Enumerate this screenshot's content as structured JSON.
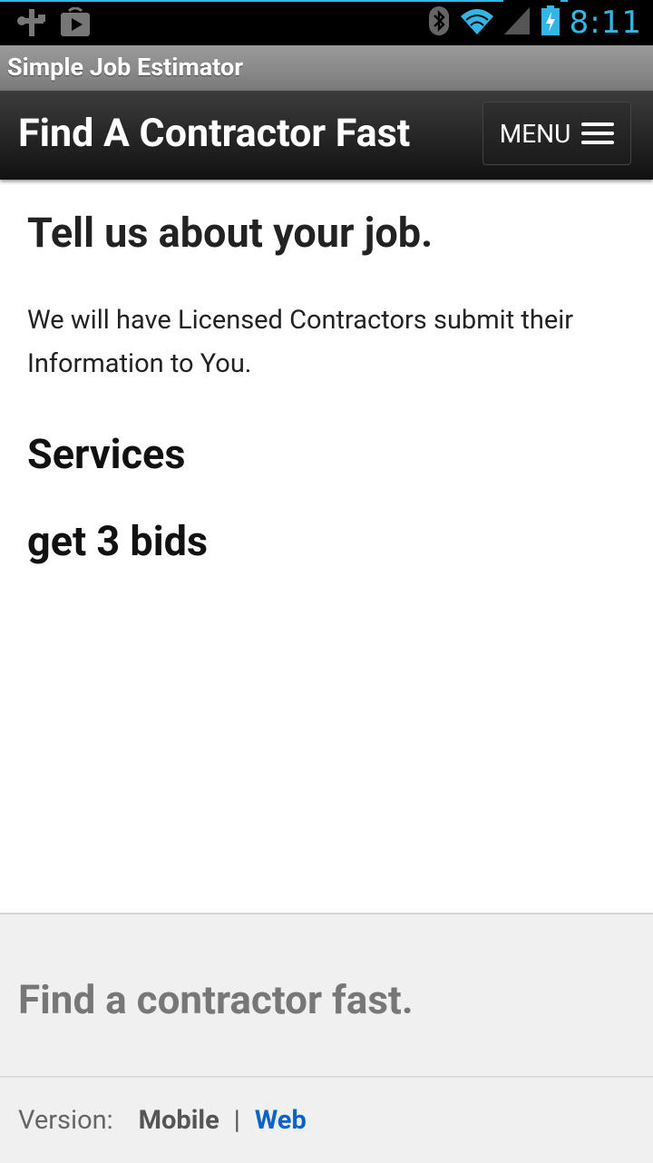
{
  "status_bar": {
    "time": "8:11",
    "icons": [
      "usb-icon",
      "play-store-icon",
      "bluetooth-icon",
      "wifi-icon",
      "signal-icon",
      "battery-charging-icon"
    ]
  },
  "app_bar": {
    "title": "Simple Job Estimator"
  },
  "header": {
    "site_title": "Find A Contractor Fast",
    "menu_label": "MENU"
  },
  "main": {
    "heading": "Tell us about your job.",
    "intro": "We will have  Licensed Contractors submit their Information to You.",
    "services_heading": "Services",
    "bids_heading": "get 3 bids"
  },
  "footer": {
    "tagline": "Find a contractor fast.",
    "version_label": "Version:",
    "mobile_label": "Mobile",
    "separator": "|",
    "web_label": "Web"
  },
  "colors": {
    "accent": "#33b5e5",
    "link": "#0a64c8",
    "header_bg": "#1a1a1a"
  }
}
